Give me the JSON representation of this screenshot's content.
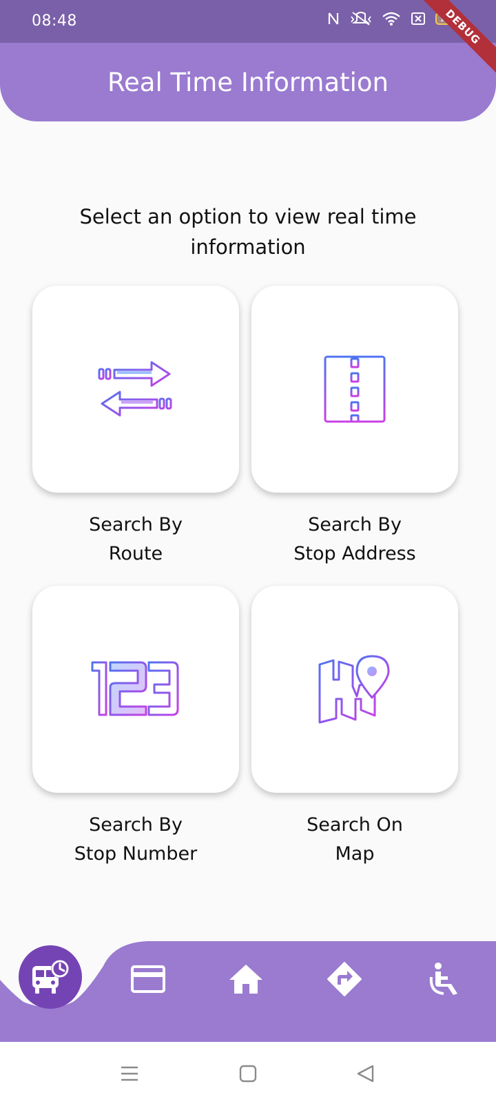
{
  "status_bar": {
    "time": "08:48",
    "battery": "100",
    "debug_banner": "DEBUG"
  },
  "header": {
    "title": "Real Time Information"
  },
  "instruction": "Select an option to view real time information",
  "options": [
    {
      "label": "Search By\nRoute",
      "icon": "route-arrows-icon"
    },
    {
      "label": "Search By\nStop Address",
      "icon": "road-icon"
    },
    {
      "label": "Search By\nStop Number",
      "icon": "numbers-123-icon"
    },
    {
      "label": "Search On\nMap",
      "icon": "map-pin-icon"
    }
  ],
  "bottom_nav": {
    "items": [
      {
        "icon": "bus-clock-icon",
        "active": true
      },
      {
        "icon": "card-icon"
      },
      {
        "icon": "home-icon"
      },
      {
        "icon": "directions-icon"
      },
      {
        "icon": "accessibility-icon"
      }
    ]
  },
  "system_nav": {
    "items": [
      "menu-icon",
      "home-square-icon",
      "back-triangle-icon"
    ]
  },
  "colors": {
    "header": "#9a7bd0",
    "status_bar": "#7a60a8",
    "fab": "#7544b4",
    "icon_gradient_start": "#5b6cf0",
    "icon_gradient_end": "#c53ee8"
  }
}
